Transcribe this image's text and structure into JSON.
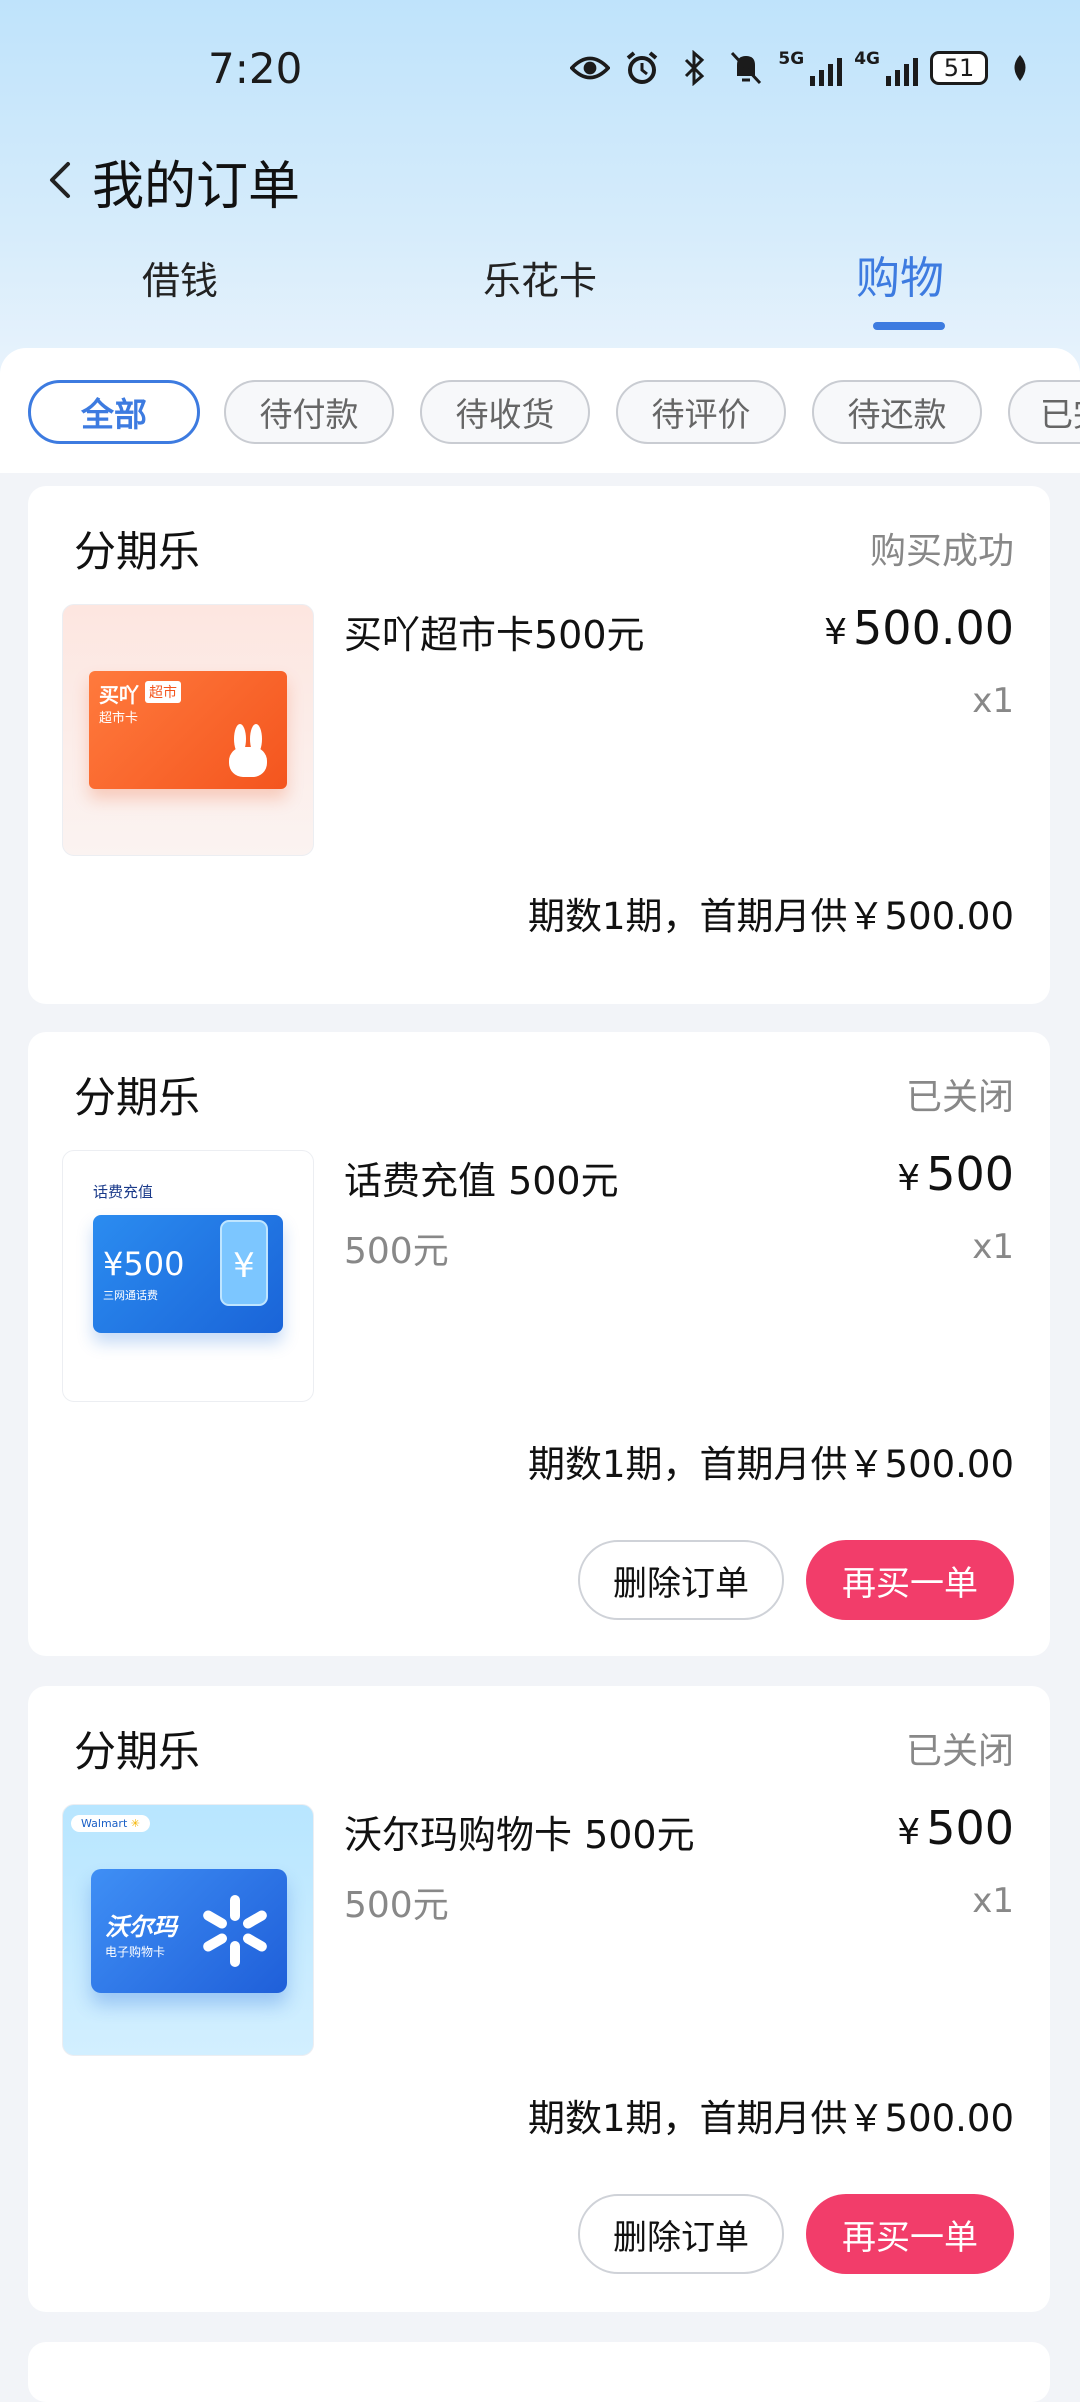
{
  "status_bar": {
    "time": "7:20",
    "net1": "5G",
    "net2": "4G",
    "battery": "51",
    "icons": [
      "eye-icon",
      "alarm-icon",
      "bluetooth-icon",
      "mute-icon",
      "signal-5g-icon",
      "signal-4g-icon",
      "battery-icon",
      "leaf-icon"
    ]
  },
  "header": {
    "title": "我的订单",
    "back_icon": "chevron-left-icon"
  },
  "tabs": [
    {
      "label": "借钱"
    },
    {
      "label": "乐花卡"
    },
    {
      "label": "购物",
      "active": true
    }
  ],
  "filters": [
    {
      "label": "全部",
      "active": true
    },
    {
      "label": "待付款"
    },
    {
      "label": "待收货"
    },
    {
      "label": "待评价"
    },
    {
      "label": "待还款"
    },
    {
      "label": "已完"
    }
  ],
  "orders": [
    {
      "merchant": "分期乐",
      "status": "购买成功",
      "product": "买吖超市卡500元",
      "subtitle": "",
      "currency": "¥",
      "price": "500.00",
      "qty": "x1",
      "installment": "期数1期，首期月供￥500.00",
      "thumb_text": {
        "brand": "买吖",
        "tag": "超市",
        "sub": "超市卡"
      },
      "buttons": []
    },
    {
      "merchant": "分期乐",
      "status": "已关闭",
      "product": "话费充值 500元",
      "subtitle": "500元",
      "currency": "¥",
      "price": "500",
      "qty": "x1",
      "installment": "期数1期，首期月供￥500.00",
      "thumb_text": {
        "head": "话费充值",
        "amount": "¥500",
        "sub": "三网通话费"
      },
      "buttons": [
        "删除订单",
        "再买一单"
      ]
    },
    {
      "merchant": "分期乐",
      "status": "已关闭",
      "product": "沃尔玛购物卡 500元",
      "subtitle": "500元",
      "currency": "¥",
      "price": "500",
      "qty": "x1",
      "installment": "期数1期，首期月供￥500.00",
      "thumb_text": {
        "logo": "Walmart",
        "logo_sub": "沃尔玛",
        "name": "沃尔玛",
        "sub": "电子购物卡"
      },
      "buttons": [
        "删除订单",
        "再买一单"
      ]
    }
  ],
  "colors": {
    "accent": "#3d7be0",
    "primary_button": "#f23d6a"
  }
}
